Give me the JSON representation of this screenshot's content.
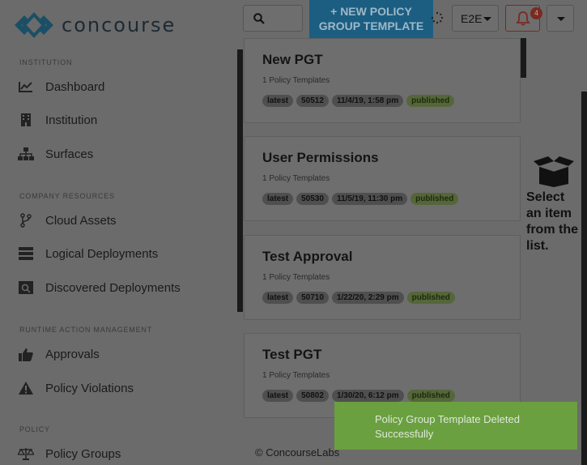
{
  "app": {
    "name": "concourse",
    "brand_color": "#1b5e82"
  },
  "sidebar": {
    "sections": [
      {
        "label": "INSTITUTION",
        "items": [
          {
            "label": "Dashboard",
            "icon": "chart-line-icon"
          },
          {
            "label": "Institution",
            "icon": "building-icon"
          },
          {
            "label": "Surfaces",
            "icon": "sitemap-icon"
          }
        ]
      },
      {
        "label": "COMPANY RESOURCES",
        "items": [
          {
            "label": "Cloud Assets",
            "icon": "branch-icon"
          },
          {
            "label": "Logical Deployments",
            "icon": "server-icon"
          },
          {
            "label": "Discovered Deployments",
            "icon": "detect-icon"
          }
        ]
      },
      {
        "label": "RUNTIME ACTION MANAGEMENT",
        "items": [
          {
            "label": "Approvals",
            "icon": "thumbs-up-icon"
          },
          {
            "label": "Policy Violations",
            "icon": "warning-icon"
          }
        ]
      },
      {
        "label": "POLICY",
        "items": [
          {
            "label": "Policy Groups",
            "icon": "balance-scale-icon"
          }
        ]
      }
    ]
  },
  "topbar": {
    "new_button_line1": "+ NEW POLICY",
    "new_button_line2": "GROUP TEMPLATE",
    "env_value": "E2E",
    "notification_count": "4"
  },
  "cards": [
    {
      "title": "New PGT",
      "subtitle": "1 Policy Templates",
      "tags": [
        "latest",
        "50512",
        "11/4/19, 1:58 pm",
        "published"
      ]
    },
    {
      "title": "User Permissions",
      "subtitle": "1 Policy Templates",
      "tags": [
        "latest",
        "50530",
        "11/5/19, 11:30 pm",
        "published"
      ]
    },
    {
      "title": "Test Approval",
      "subtitle": "1 Policy Templates",
      "tags": [
        "latest",
        "50710",
        "1/22/20, 2:29 pm",
        "published"
      ]
    },
    {
      "title": "Test PGT",
      "subtitle": "1 Policy Templates",
      "tags": [
        "latest",
        "50802",
        "1/30/20, 6:12 pm",
        "published"
      ]
    }
  ],
  "empty_state": {
    "line1": "Select",
    "line2": "an item",
    "line3": "from the",
    "line4": "list.",
    "icon": "open-box-icon"
  },
  "footer": {
    "text": "© ConcourseLabs"
  },
  "toast": {
    "line1": "Policy Group Template Deleted",
    "line2": "Successfully",
    "color": "#6aa040"
  }
}
